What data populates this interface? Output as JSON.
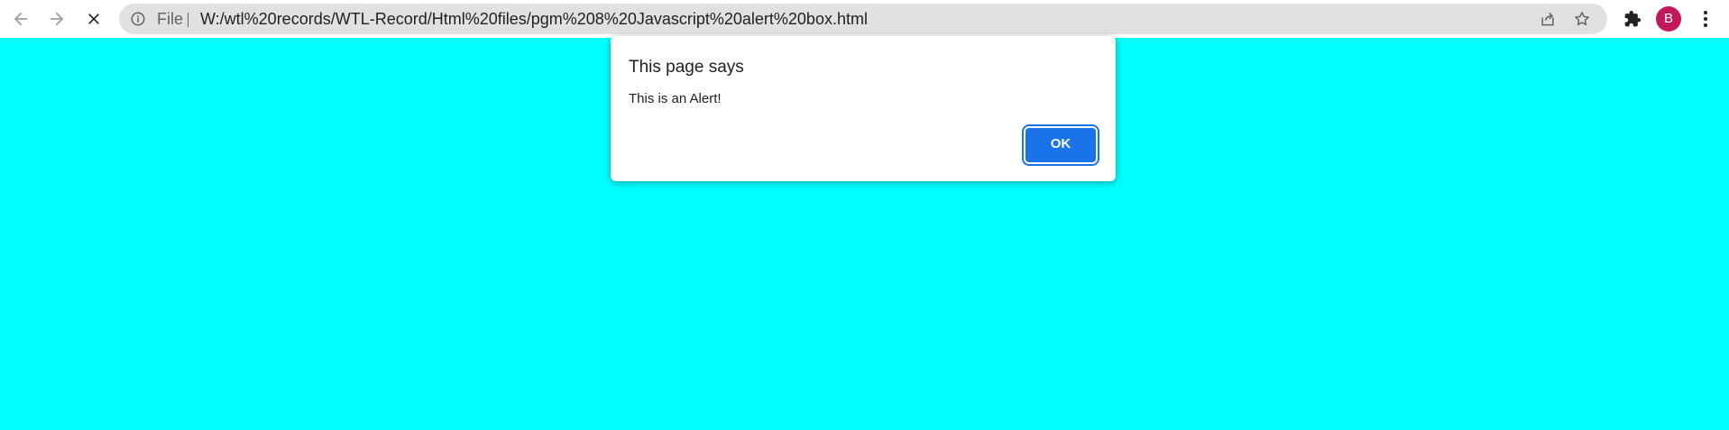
{
  "browser": {
    "back_icon": "arrow-left-icon",
    "forward_icon": "arrow-right-icon",
    "stop_icon": "close-icon",
    "omnibox": {
      "info_icon": "info-icon",
      "scheme": "File",
      "url": "W:/wtl%20records/WTL-Record/Html%20files/pgm%208%20Javascript%20alert%20box.html",
      "share_icon": "share-icon",
      "bookmark_icon": "star-icon"
    },
    "extensions_icon": "puzzle-icon",
    "profile_initial": "B",
    "menu_icon": "kebab-menu-icon"
  },
  "page": {
    "background_color": "#00ffff"
  },
  "alert": {
    "title": "This page says",
    "message": "This is an Alert!",
    "ok_label": "OK",
    "button_color": "#1a73e8"
  }
}
